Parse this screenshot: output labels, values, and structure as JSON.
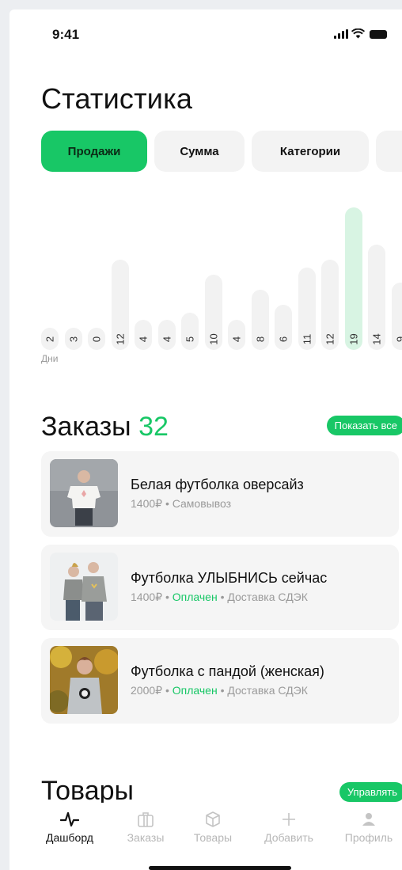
{
  "status": {
    "time": "9:41"
  },
  "title": "Статистика",
  "chips": [
    {
      "label": "Продажи",
      "active": true
    },
    {
      "label": "Сумма",
      "active": false
    },
    {
      "label": "Категории",
      "active": false
    },
    {
      "label": "",
      "active": false
    }
  ],
  "chart_data": {
    "type": "bar",
    "xlabel": "Дни",
    "values": [
      2,
      3,
      0,
      12,
      4,
      4,
      5,
      10,
      4,
      8,
      6,
      11,
      12,
      19,
      14,
      9
    ],
    "highlight_index": 13,
    "colors": {
      "bar": "#f2f2f2",
      "highlight": "#d8f4e3"
    }
  },
  "orders": {
    "title": "Заказы",
    "count": "32",
    "show_all": "Показать все",
    "items": [
      {
        "name": "Белая футболка оверсайз",
        "price": "1400₽",
        "sep1": "•",
        "status": "",
        "sep2": "",
        "delivery": "Самовывоз"
      },
      {
        "name": "Футболка УЛЫБНИСЬ сейчас",
        "price": "1400₽",
        "sep1": "•",
        "status": "Оплачен",
        "sep2": "•",
        "delivery": "Доставка СДЭК"
      },
      {
        "name": "Футболка с пандой (женская)",
        "price": "2000₽",
        "sep1": "•",
        "status": "Оплачен",
        "sep2": "•",
        "delivery": "Доставка СДЭК"
      }
    ]
  },
  "goods": {
    "title": "Товары",
    "manage": "Управлять"
  },
  "tabs": [
    {
      "label": "Дашборд",
      "icon": "activity-icon",
      "active": true
    },
    {
      "label": "Заказы",
      "icon": "briefcase-icon",
      "active": false
    },
    {
      "label": "Товары",
      "icon": "box-icon",
      "active": false
    },
    {
      "label": "Добавить",
      "icon": "plus-icon",
      "active": false
    },
    {
      "label": "Профиль",
      "icon": "user-icon",
      "active": false
    }
  ],
  "accent": "#18c766"
}
